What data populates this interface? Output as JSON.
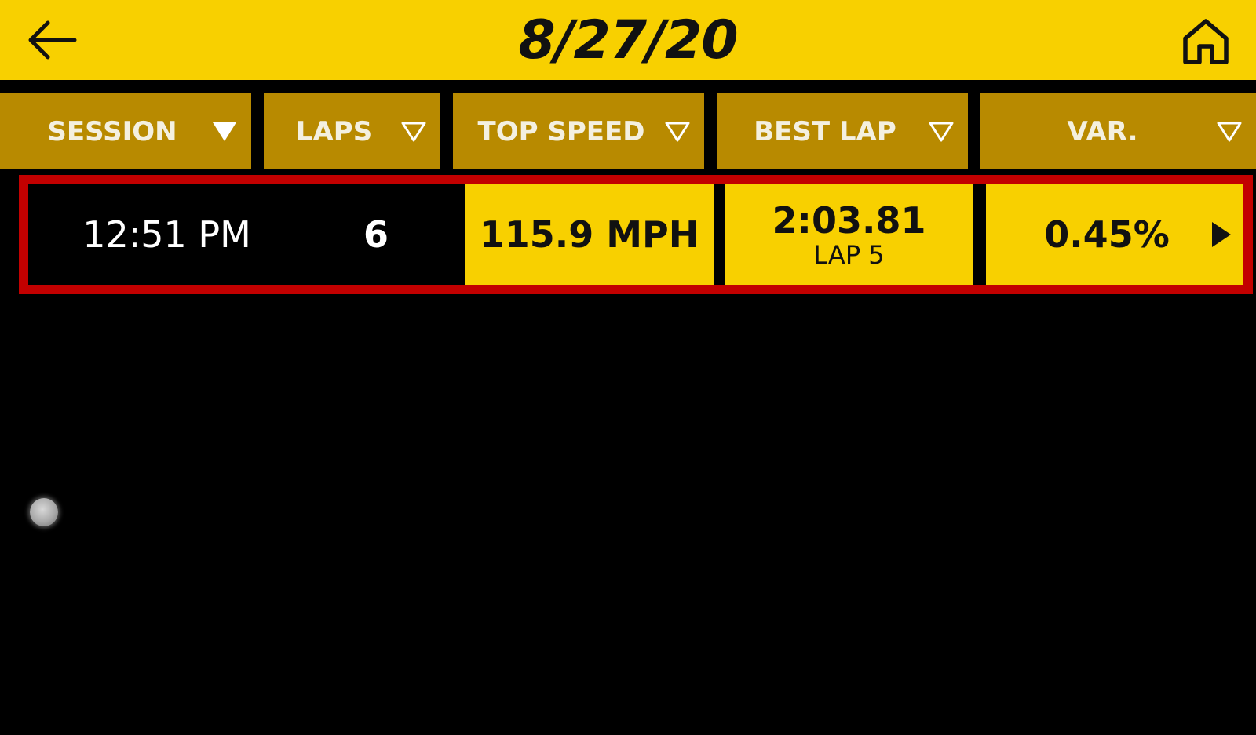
{
  "header": {
    "title": "8/27/20",
    "back_icon": "arrow-left-icon",
    "home_icon": "home-icon",
    "background": "#F8D000"
  },
  "columns": [
    {
      "label": "SESSION",
      "sort_icon": "triangle-down-filled-icon"
    },
    {
      "label": "LAPS",
      "sort_icon": "triangle-down-outline-icon"
    },
    {
      "label": "TOP SPEED",
      "sort_icon": "triangle-down-outline-icon"
    },
    {
      "label": "BEST LAP",
      "sort_icon": "triangle-down-outline-icon"
    },
    {
      "label": "VAR.",
      "sort_icon": "triangle-down-outline-icon"
    }
  ],
  "sessions": [
    {
      "time": "12:51 PM",
      "laps": "6",
      "top_speed": "115.9 MPH",
      "best_lap": "2:03.81",
      "best_lap_sub": "LAP 5",
      "variance": "0.45%",
      "selected": true,
      "open_icon": "chevron-right-filled-icon"
    }
  ],
  "colors": {
    "accent_yellow": "#F8D000",
    "header_gold": "#B88A00",
    "selection_red": "#C20000",
    "background": "#000000"
  }
}
